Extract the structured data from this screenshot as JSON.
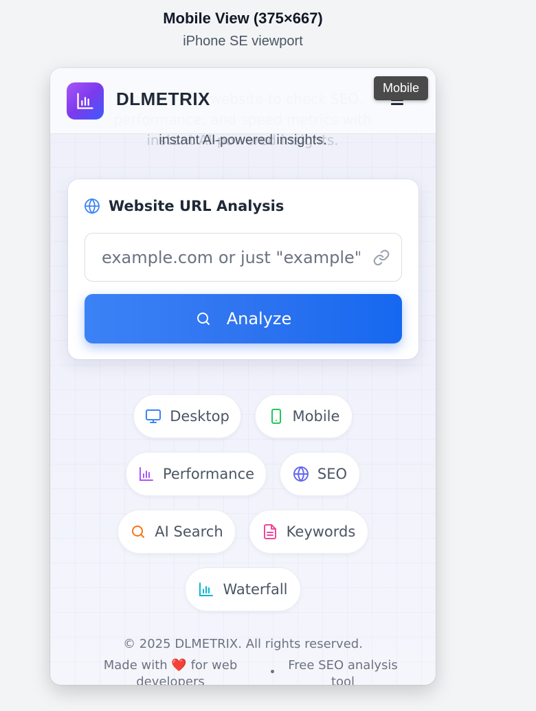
{
  "viewport": {
    "title": "Mobile View (375×667)",
    "subtitle": "iPhone SE viewport"
  },
  "header": {
    "brand": "DLMETRIX",
    "menu_icon": "hamburger-menu-icon",
    "tooltip": "Mobile"
  },
  "hero": {
    "hidden_text": "Analyze any website to check SEO, performance, and speed metrics with instant AI-powered insights.",
    "visible_line": "instant AI-powered insights."
  },
  "analysis_card": {
    "title": "Website URL Analysis",
    "input_placeholder": "example.com or just \"example\"",
    "input_value": "",
    "button_label": "Analyze"
  },
  "features": [
    {
      "label": "Desktop",
      "icon": "monitor-icon",
      "color": "#3b82f6"
    },
    {
      "label": "Mobile",
      "icon": "smartphone-icon",
      "color": "#22c55e"
    },
    {
      "label": "Performance",
      "icon": "bar-chart-icon",
      "color": "#a855f7"
    },
    {
      "label": "SEO",
      "icon": "globe-icon",
      "color": "#6366f1"
    },
    {
      "label": "AI Search",
      "icon": "search-icon",
      "color": "#f97316"
    },
    {
      "label": "Keywords",
      "icon": "document-icon",
      "color": "#ec4899"
    },
    {
      "label": "Waterfall",
      "icon": "bar-chart-icon",
      "color": "#06b6d4"
    }
  ],
  "footer": {
    "copyright": "© 2025 DLMETRIX. All rights reserved.",
    "made_prefix": "Made with",
    "made_suffix": "for web developers",
    "free_text": "Free SEO analysis tool"
  },
  "colors": {
    "accent": "#2563eb",
    "brand_gradient_start": "#a855f7",
    "brand_gradient_end": "#3b5bfd"
  }
}
